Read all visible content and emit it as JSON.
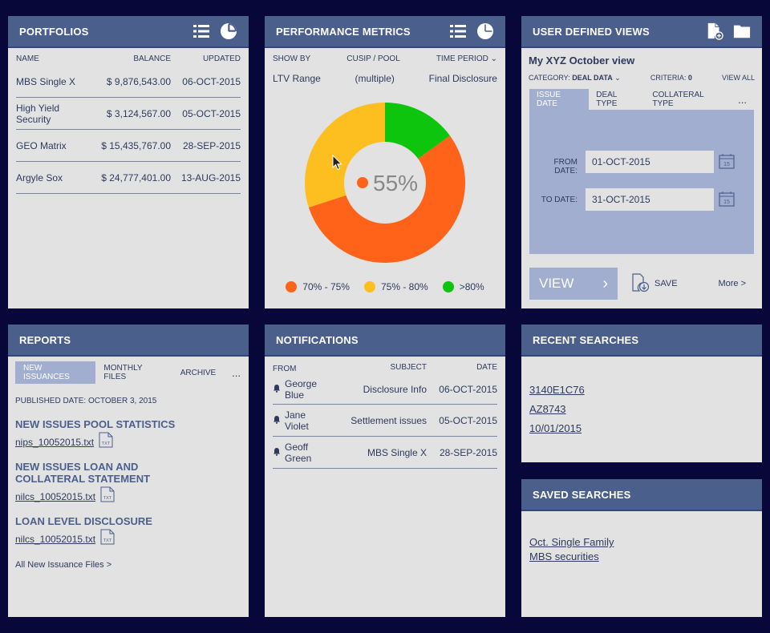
{
  "portfolios": {
    "title": "PORTFOLIOS",
    "columns": {
      "name": "NAME",
      "balance": "BALANCE",
      "updated": "UPDATED"
    },
    "rows": [
      {
        "name": "MBS Single X",
        "balance": "$ 9,876,543.00",
        "updated": "06-OCT-2015"
      },
      {
        "name": "High Yield Security",
        "balance": "$ 3,124,567.00",
        "updated": "05-OCT-2015"
      },
      {
        "name": "GEO Matrix",
        "balance": "$ 15,435,767.00",
        "updated": "28-SEP-2015"
      },
      {
        "name": "Argyle Sox",
        "balance": "$ 24,777,401.00",
        "updated": "13-AUG-2015"
      }
    ]
  },
  "performance": {
    "title": "PERFORMANCE METRICS",
    "show_by_label": "SHOW BY",
    "cusip_label": "CUSIP / POOL",
    "time_period_label": "TIME PERIOD",
    "show_by_value": "LTV Range",
    "cusip_value": "(multiple)",
    "time_period_value": "Final Disclosure",
    "center_value": "55%",
    "chart": {
      "type": "donut",
      "series": [
        {
          "label": "70% - 75%",
          "value": 55,
          "color": "#ff6319"
        },
        {
          "label": "75% - 80%",
          "value": 30,
          "color": "#fdbf20"
        },
        {
          "label": ">80%",
          "value": 15,
          "color": "#0dc50d"
        }
      ]
    }
  },
  "udv": {
    "title": "USER DEFINED VIEWS",
    "view_name": "My XYZ October view",
    "category_label": "CATEGORY:",
    "category_value": "DEAL DATA",
    "criteria_label": "CRITERIA:",
    "criteria_value": "0",
    "view_all": "VIEW ALL",
    "tabs": [
      "ISSUE DATE",
      "DEAL TYPE",
      "COLLATERAL TYPE"
    ],
    "tabs_more": "...",
    "from_label": "FROM DATE:",
    "from_value": "01-OCT-2015",
    "to_label": "TO DATE:",
    "to_value": "31-OCT-2015",
    "calendar_day": "15",
    "view_button": "VIEW",
    "save_button": "SAVE",
    "more_link": "More >"
  },
  "reports": {
    "title": "REPORTS",
    "tabs": [
      "NEW ISSUANCES",
      "MONTHLY FILES",
      "ARCHIVE"
    ],
    "tabs_more": "...",
    "published": "PUBLISHED DATE: OCTOBER 3, 2015",
    "sections": [
      {
        "title": "NEW ISSUES POOL STATISTICS",
        "file": "nips_10052015.txt"
      },
      {
        "title": "NEW ISSUES LOAN AND COLLATERAL STATEMENT",
        "file": "nilcs_10052015.txt"
      },
      {
        "title": "LOAN LEVEL DISCLOSURE",
        "file": "nilcs_10052015.txt"
      }
    ],
    "file_badge": "TXT",
    "all_link": "All New Issuance Files >"
  },
  "notifications": {
    "title": "NOTIFICATIONS",
    "columns": {
      "from": "FROM",
      "subject": "SUBJECT",
      "date": "DATE"
    },
    "rows": [
      {
        "from": "George Blue",
        "subject": "Disclosure Info",
        "date": "06-OCT-2015"
      },
      {
        "from": "Jane Violet",
        "subject": "Settlement issues",
        "date": "05-OCT-2015"
      },
      {
        "from": "Geoff Green",
        "subject": "MBS Single X",
        "date": "28-SEP-2015"
      }
    ]
  },
  "recent": {
    "title": "RECENT SEARCHES",
    "items": [
      "3140E1C76",
      "AZ8743",
      "10/01/2015"
    ]
  },
  "saved": {
    "title": "SAVED SEARCHES",
    "items": [
      "Oct. Single Family",
      "MBS securities"
    ]
  }
}
